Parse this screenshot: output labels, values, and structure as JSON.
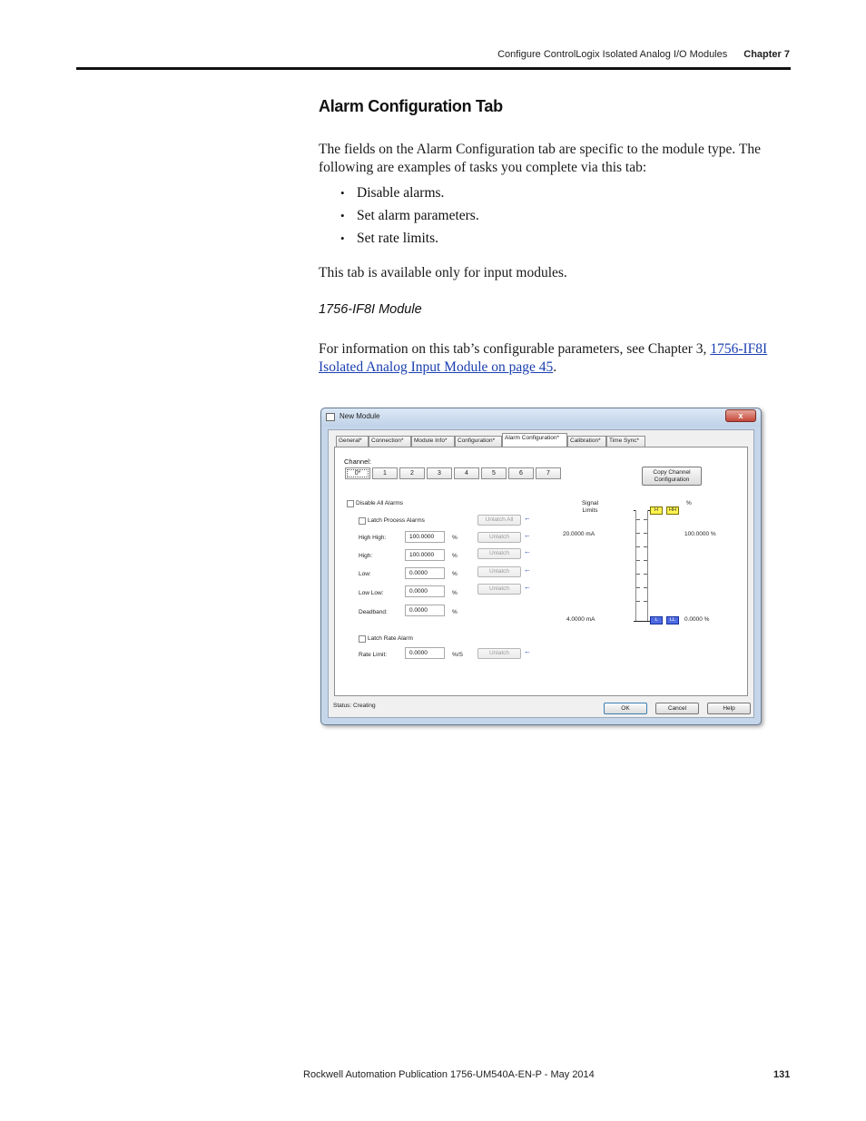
{
  "header": {
    "section": "Configure ControlLogix Isolated Analog I/O Modules",
    "chapter": "Chapter 7"
  },
  "heading": "Alarm Configuration Tab",
  "intro": "The fields on the Alarm Configuration tab are specific to the module type. The following are examples of tasks you complete via this tab:",
  "bullets": [
    "Disable alarms.",
    "Set alarm parameters.",
    "Set rate limits."
  ],
  "availability": "This tab is available only for input modules.",
  "subheading": "1756-IF8I Module",
  "ref": {
    "prefix": "For information on this tab’s configurable parameters, see Chapter 3, ",
    "link": "1756-IF8I Isolated Analog Input Module on page 45",
    "suffix": "."
  },
  "dialog": {
    "title": "New Module",
    "close": "x",
    "tabs": [
      "General*",
      "Connection*",
      "Module Info*",
      "Configuration*",
      "Alarm Configuration*",
      "Calibration*",
      "Time Sync*"
    ],
    "active_tab": 4,
    "channel_label": "Channel:",
    "channels": [
      "0*",
      "1",
      "2",
      "3",
      "4",
      "5",
      "6",
      "7"
    ],
    "copy_btn": "Copy Channel Configuration",
    "disable_all": "Disable All Alarms",
    "latch_process": "Latch Process Alarms",
    "unlatch_all": "Unlatch All",
    "unlatch": "Unlatch",
    "rows": [
      {
        "label": "High High:",
        "value": "100.0000",
        "unit": "%"
      },
      {
        "label": "High:",
        "value": "100.0000",
        "unit": "%"
      },
      {
        "label": "Low:",
        "value": "0.0000",
        "unit": "%"
      },
      {
        "label": "Low Low:",
        "value": "0.0000",
        "unit": "%"
      },
      {
        "label": "Deadband:",
        "value": "0.0000",
        "unit": "%"
      }
    ],
    "latch_rate": "Latch Rate Alarm",
    "rate_label": "Rate Limit:",
    "rate_value": "0.0000",
    "rate_unit": "%/S",
    "signal_title": "Signal Limits",
    "pct_title": "%",
    "signal_high": "20.0000 mA",
    "signal_low": "4.0000 mA",
    "pct_high": "100.0000 %",
    "pct_low": "0.0000 %",
    "marker_h": "H",
    "marker_hh": "HH",
    "marker_l": "L",
    "marker_ll": "LL",
    "status": "Status: Creating",
    "ok": "OK",
    "cancel": "Cancel",
    "help": "Help"
  },
  "footer": {
    "publication": "Rockwell Automation Publication 1756-UM540A-EN-P - May 2014",
    "page": "131"
  }
}
